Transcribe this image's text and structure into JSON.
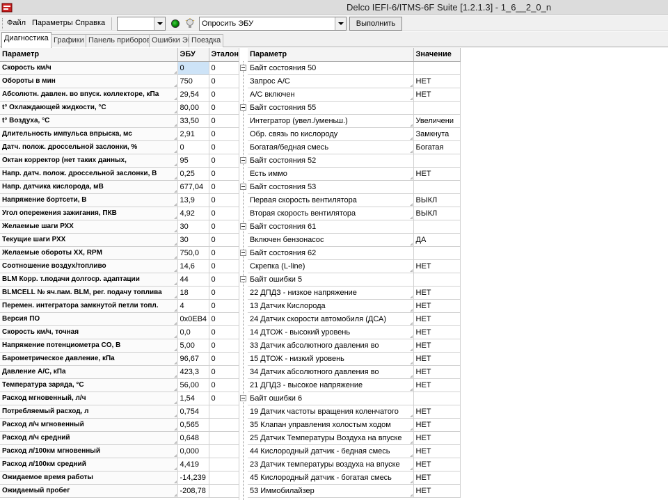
{
  "window": {
    "title": "Delco IEFI-6/ITMS-6F Suite [1.2.1.3] - 1_6__2_0_n"
  },
  "menu": [
    "Файл",
    "Параметры",
    "Справка"
  ],
  "toolbar": {
    "combo1_value": "",
    "query_value": "Опросить ЭБУ",
    "run_label": "Выполнить"
  },
  "tabs": [
    "Диагностика",
    "Графики",
    "Панель приборов",
    "Ошибки ЭБУ",
    "Поездка"
  ],
  "left_table": {
    "headers": [
      "Параметр",
      "ЭБУ",
      "Эталон"
    ],
    "rows": [
      [
        "Скорость км/ч",
        "0",
        "0"
      ],
      [
        "Обороты в мин",
        "750",
        "0"
      ],
      [
        "Абсолютн. давлен. во впуск. коллекторе, кПа",
        "29,54",
        "0"
      ],
      [
        "t° Охлаждающей жидкости, °C",
        "80,00",
        "0"
      ],
      [
        "t° Воздуха, °C",
        "33,50",
        "0"
      ],
      [
        "Длительность импульса впрыска, мс",
        "2,91",
        "0"
      ],
      [
        "Датч. полож. дроссельной заслонки, %",
        "0",
        "0"
      ],
      [
        "Октан корректор (нет таких данных,",
        "95",
        "0"
      ],
      [
        "Напр. датч. полож. дроссельной заслонки, В",
        "0,25",
        "0"
      ],
      [
        "Напр. датчика кислорода, мВ",
        "677,04",
        "0"
      ],
      [
        "Напряжение бортсети, В",
        "13,9",
        "0"
      ],
      [
        "Угол опережения зажигания, ПКВ",
        "4,92",
        "0"
      ],
      [
        "Желаемые шаги РХХ",
        "30",
        "0"
      ],
      [
        "Текущие шаги РХХ",
        "30",
        "0"
      ],
      [
        "Желаемые обороты ХХ, RPM",
        "750,0",
        "0"
      ],
      [
        "Соотношение воздух/топливо",
        "14,6",
        "0"
      ],
      [
        "BLM Корр. т.подачи долгоср. адаптации",
        "44",
        "0"
      ],
      [
        "BLMCELL № яч.пам. BLM, рег. подачу топлива",
        "18",
        "0"
      ],
      [
        "Перемен. интегратора замкнутой петли топл.",
        "4",
        "0"
      ],
      [
        "Версия ПО",
        "0x0EB4",
        "0"
      ],
      [
        "Скорость км/ч, точная",
        "0,0",
        "0"
      ],
      [
        "Напряжение потенциометра CO, В",
        "5,00",
        "0"
      ],
      [
        "Барометрическое давление, кПа",
        "96,67",
        "0"
      ],
      [
        "Давление А/С, кПа",
        "423,3",
        "0"
      ],
      [
        "Температура заряда, °C",
        "56,00",
        "0"
      ],
      [
        "Расход мгновенный, л/ч",
        "1,54",
        "0"
      ],
      [
        "Потребляемый расход, л",
        "0,754",
        ""
      ],
      [
        "Расход л/ч мгновенный",
        "0,565",
        ""
      ],
      [
        "Расход л/ч средний",
        "0,648",
        ""
      ],
      [
        "Расход л/100км мгновенный",
        "0,000",
        ""
      ],
      [
        "Расход л/100км средний",
        "4,419",
        ""
      ],
      [
        "Ожидаемое время работы",
        "-14,239",
        ""
      ],
      [
        "Ожидаемый пробег",
        "-208,78",
        ""
      ]
    ]
  },
  "right_table": {
    "headers": [
      "Параметр",
      "Значение"
    ],
    "rows": [
      {
        "group": true,
        "label": "Байт состояния 50",
        "value": ""
      },
      {
        "group": false,
        "label": "Запрос А/С",
        "value": "НЕТ"
      },
      {
        "group": false,
        "label": "А/С включен",
        "value": "НЕТ"
      },
      {
        "group": true,
        "label": "Байт состояния 55",
        "value": ""
      },
      {
        "group": false,
        "label": "Интегратор (увел./уменьш.)",
        "value": "Увеличени"
      },
      {
        "group": false,
        "label": "Обр. связь по кислороду",
        "value": "Замкнута"
      },
      {
        "group": false,
        "label": "Богатая/бедная смесь",
        "value": "Богатая"
      },
      {
        "group": true,
        "label": "Байт состояния 52",
        "value": ""
      },
      {
        "group": false,
        "label": "Есть иммо",
        "value": "НЕТ"
      },
      {
        "group": true,
        "label": "Байт состояния 53",
        "value": ""
      },
      {
        "group": false,
        "label": "Первая скорость вентилятора",
        "value": "ВЫКЛ"
      },
      {
        "group": false,
        "label": "Вторая скорость вентилятора",
        "value": "ВЫКЛ"
      },
      {
        "group": true,
        "label": "Байт состояния 61",
        "value": ""
      },
      {
        "group": false,
        "label": "Включен бензонасос",
        "value": "ДА"
      },
      {
        "group": true,
        "label": "Байт состояния 62",
        "value": ""
      },
      {
        "group": false,
        "label": "Скрепка (L-line)",
        "value": "НЕТ"
      },
      {
        "group": true,
        "label": "Байт ошибки 5",
        "value": ""
      },
      {
        "group": false,
        "label": "22 ДПДЗ - низкое напряжение",
        "value": "НЕТ"
      },
      {
        "group": false,
        "label": "13 Датчик Кислорода",
        "value": "НЕТ"
      },
      {
        "group": false,
        "label": "24 Датчик скорости автомобиля (ДСА)",
        "value": "НЕТ"
      },
      {
        "group": false,
        "label": "14 ДТОЖ - высокий уровень",
        "value": "НЕТ"
      },
      {
        "group": false,
        "label": "33 Датчик абсолютного давления во",
        "value": "НЕТ"
      },
      {
        "group": false,
        "label": "15 ДТОЖ - низкий уровень",
        "value": "НЕТ"
      },
      {
        "group": false,
        "label": "34 Датчик абсолютного давления во",
        "value": "НЕТ"
      },
      {
        "group": false,
        "label": "21 ДПДЗ - высокое напряжение",
        "value": "НЕТ"
      },
      {
        "group": true,
        "label": "Байт ошибки 6",
        "value": ""
      },
      {
        "group": false,
        "label": "19 Датчик частоты вращения коленчатого",
        "value": "НЕТ"
      },
      {
        "group": false,
        "label": "35 Клапан управления холостым ходом",
        "value": "НЕТ"
      },
      {
        "group": false,
        "label": "25 Датчик Температуры Воздуха на впуске",
        "value": "НЕТ"
      },
      {
        "group": false,
        "label": "44 Кислородный датчик - бедная смесь",
        "value": "НЕТ"
      },
      {
        "group": false,
        "label": "23 Датчик температуры воздуха на впуске",
        "value": "НЕТ"
      },
      {
        "group": false,
        "label": "45 Кислородный датчик - богатая смесь",
        "value": "НЕТ"
      },
      {
        "group": false,
        "label": "53 Иммобилайзер",
        "value": "НЕТ"
      }
    ]
  },
  "colors": {
    "selection": "#cde3f7",
    "titlebar": "#dcdcdc"
  }
}
